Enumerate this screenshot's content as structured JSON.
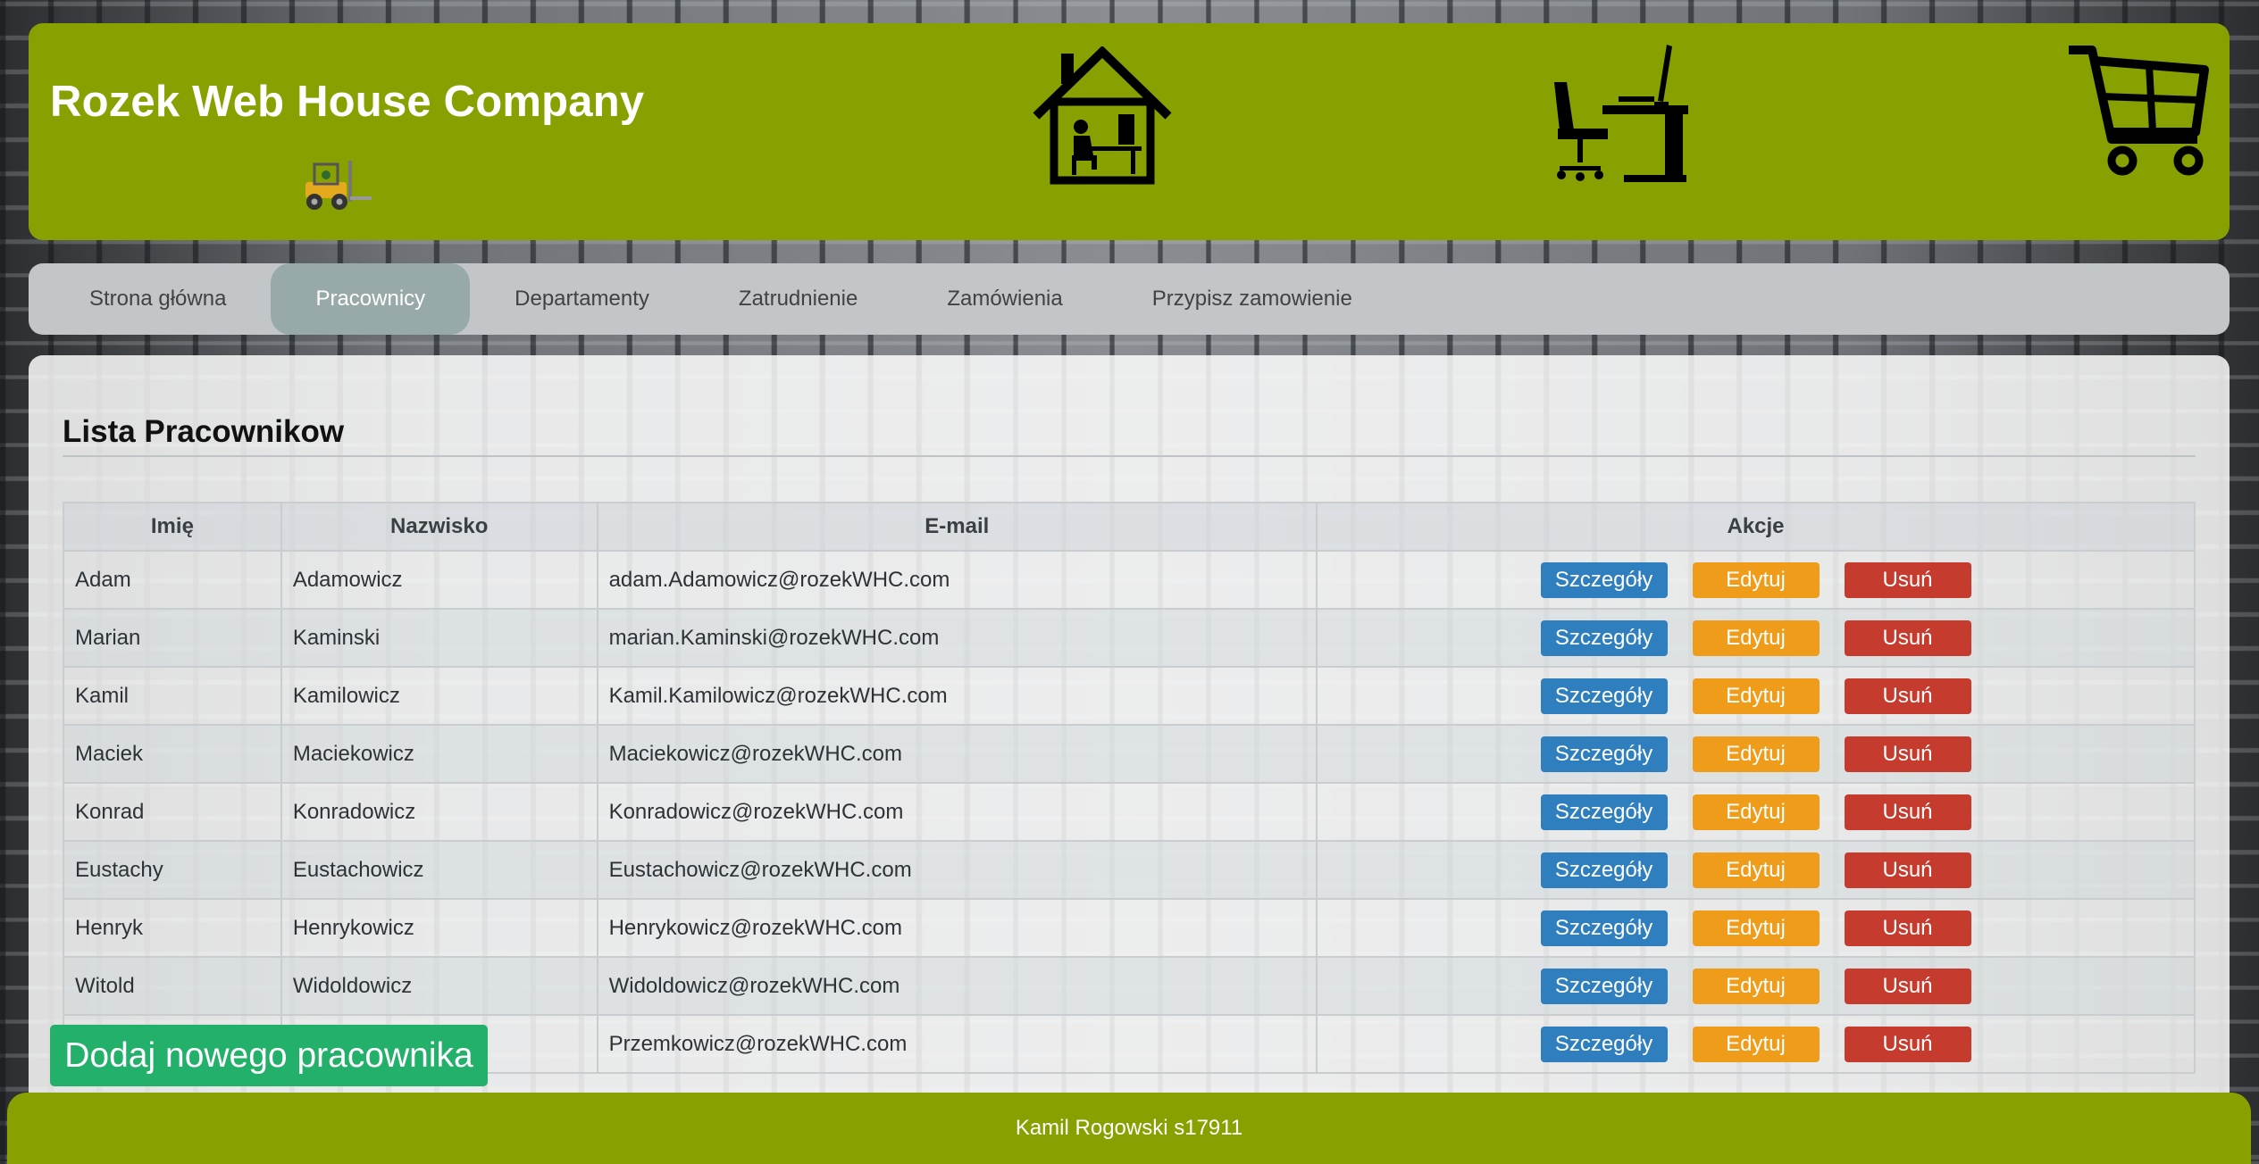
{
  "header": {
    "company_name": "Rozek Web House Company",
    "icons": [
      "forklift-icon",
      "home-office-icon",
      "office-desk-icon",
      "shopping-cart-icon"
    ]
  },
  "nav": {
    "items": [
      {
        "label": "Strona główna",
        "active": false
      },
      {
        "label": "Pracownicy",
        "active": true
      },
      {
        "label": "Departamenty",
        "active": false
      },
      {
        "label": "Zatrudnienie",
        "active": false
      },
      {
        "label": "Zamówienia",
        "active": false
      },
      {
        "label": "Przypisz zamowienie",
        "active": false
      }
    ]
  },
  "main": {
    "title": "Lista Pracownikow",
    "columns": [
      "Imię",
      "Nazwisko",
      "E-mail",
      "Akcje"
    ],
    "actions": {
      "details": "Szczegóły",
      "edit": "Edytuj",
      "delete": "Usuń"
    },
    "rows": [
      {
        "first": "Adam",
        "last": "Adamowicz",
        "email": "adam.Adamowicz@rozekWHC.com"
      },
      {
        "first": "Marian",
        "last": "Kaminski",
        "email": "marian.Kaminski@rozekWHC.com"
      },
      {
        "first": "Kamil",
        "last": "Kamilowicz",
        "email": "Kamil.Kamilowicz@rozekWHC.com"
      },
      {
        "first": "Maciek",
        "last": "Maciekowicz",
        "email": "Maciekowicz@rozekWHC.com"
      },
      {
        "first": "Konrad",
        "last": "Konradowicz",
        "email": "Konradowicz@rozekWHC.com"
      },
      {
        "first": "Eustachy",
        "last": "Eustachowicz",
        "email": "Eustachowicz@rozekWHC.com"
      },
      {
        "first": "Henryk",
        "last": "Henrykowicz",
        "email": "Henrykowicz@rozekWHC.com"
      },
      {
        "first": "Witold",
        "last": "Widoldowicz",
        "email": "Widoldowicz@rozekWHC.com"
      },
      {
        "first": "",
        "last": "",
        "email": "Przemkowicz@rozekWHC.com"
      }
    ],
    "add_button": "Dodaj nowego pracownika"
  },
  "footer": {
    "text": "Kamil Rogowski s17911"
  },
  "colors": {
    "header_green": "#88a000",
    "nav_bg": "#c2c6c9",
    "nav_active": "#98a9a9",
    "details_blue": "#2f7fbe",
    "edit_orange": "#ef9c1a",
    "delete_red": "#c53b2d",
    "add_green": "#22b06a"
  }
}
